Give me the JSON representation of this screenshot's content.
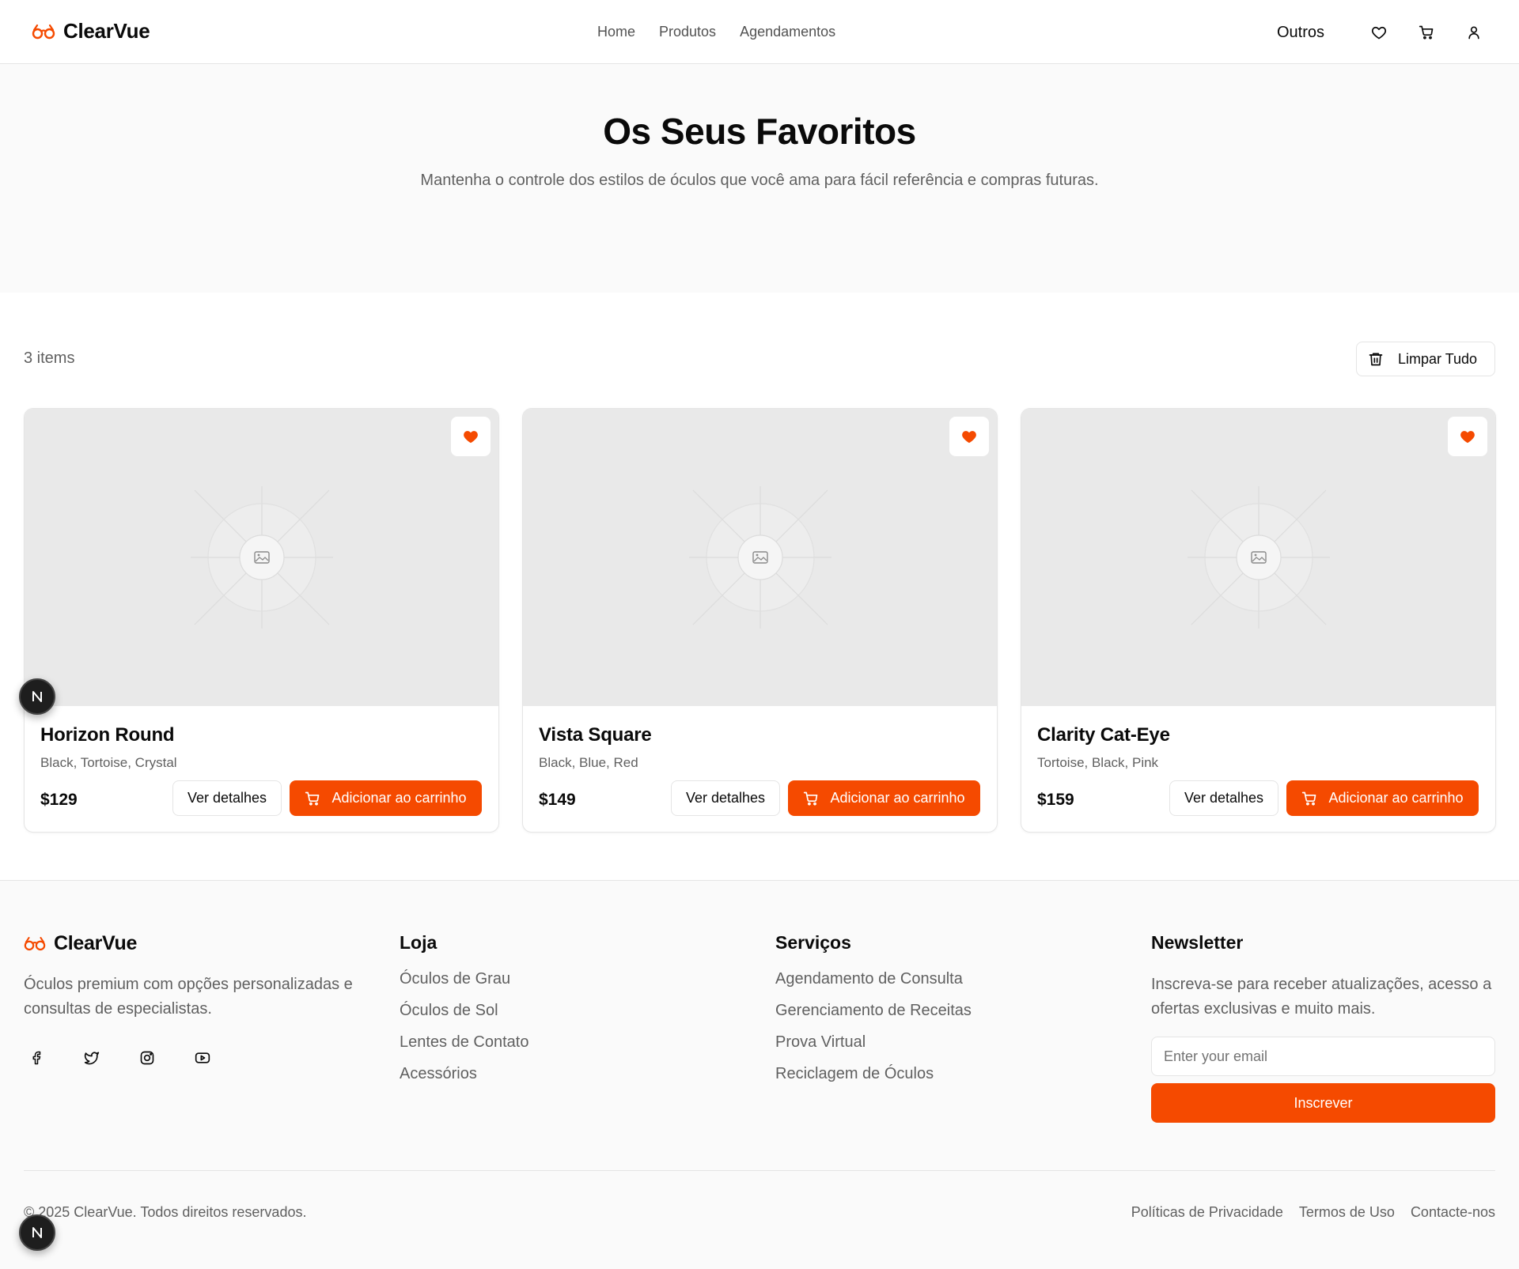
{
  "brand": {
    "name": "ClearVue",
    "accent": "#f54a00"
  },
  "nav": {
    "items": [
      "Home",
      "Produtos",
      "Agendamentos"
    ],
    "other": "Outros"
  },
  "header_icons": [
    "heart-icon",
    "cart-icon",
    "user-icon"
  ],
  "hero": {
    "title": "Os Seus Favoritos",
    "subtitle": "Mantenha o controle dos estilos de óculos que você ama para fácil referência e compras futuras."
  },
  "favorites": {
    "count_text": "3 items",
    "clear_label": "Limpar Tudo",
    "details_label": "Ver detalhes",
    "cart_label": "Adicionar ao carrinho",
    "items": [
      {
        "name": "Horizon Round",
        "colors": "Black, Tortoise, Crystal",
        "price": "$129"
      },
      {
        "name": "Vista Square",
        "colors": "Black, Blue, Red",
        "price": "$149"
      },
      {
        "name": "Clarity Cat-Eye",
        "colors": "Tortoise, Black, Pink",
        "price": "$159"
      }
    ]
  },
  "footer": {
    "brand": "ClearVue",
    "about": "Óculos premium com opções personalizadas e consultas de especialistas.",
    "socials": [
      "facebook-icon",
      "twitter-icon",
      "instagram-icon",
      "youtube-icon"
    ],
    "shop": {
      "title": "Loja",
      "links": [
        "Óculos de Grau",
        "Óculos de Sol",
        "Lentes de Contato",
        "Acessórios"
      ]
    },
    "services": {
      "title": "Serviços",
      "links": [
        "Agendamento de Consulta",
        "Gerenciamento de Receitas",
        "Prova Virtual",
        "Reciclagem de Óculos"
      ]
    },
    "newsletter": {
      "title": "Newsletter",
      "text": "Inscreva-se para receber atualizações, acesso a ofertas exclusivas e muito mais.",
      "placeholder": "Enter your email",
      "button": "Inscrever"
    },
    "copyright": "© 2025 ClearVue. Todos direitos reservados.",
    "legal": [
      "Políticas de Privacidade",
      "Termos de Uso",
      "Contacte-nos"
    ]
  },
  "dev_badge": "N"
}
